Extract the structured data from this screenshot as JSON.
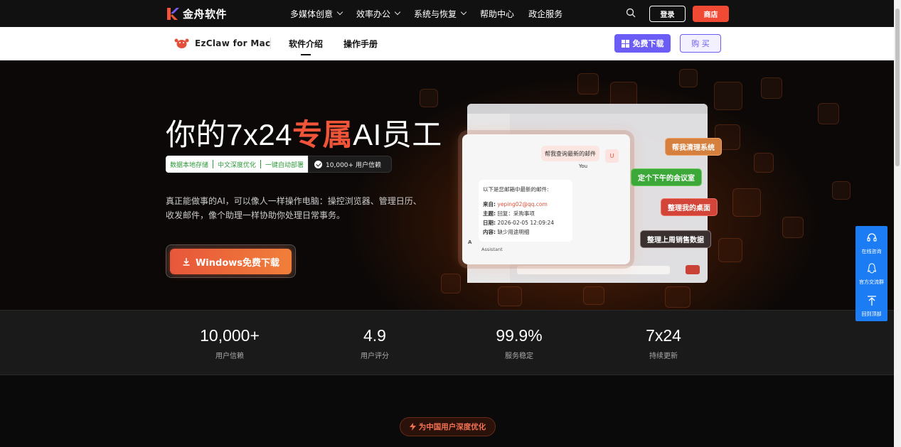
{
  "topnav": {
    "brand": "金舟软件",
    "items": [
      {
        "label": "多媒体创意",
        "dropdown": true
      },
      {
        "label": "效率办公",
        "dropdown": true
      },
      {
        "label": "系统与恢复",
        "dropdown": true
      },
      {
        "label": "帮助中心",
        "dropdown": false
      },
      {
        "label": "政企服务",
        "dropdown": false
      }
    ],
    "login": "登录",
    "shop": "商店"
  },
  "subnav": {
    "product": "EzClaw for Mac",
    "tabs": [
      "软件介绍",
      "操作手册"
    ],
    "download": "免费下载",
    "buy": "购 买"
  },
  "hero": {
    "title_pre": "你的7x24",
    "title_hl": "专属",
    "title_post": "AI员工",
    "tags": [
      "数据本地存储",
      "中文深度优化",
      "一键自动部署"
    ],
    "users": "10,000+ 用户信赖",
    "desc": "真正能做事的AI，可以像人一样操作电脑：操控浏览器、管理日历、收发邮件，像个助理一样协助你处理日常事务。",
    "win_button": "Windows免费下载"
  },
  "chat": {
    "user_msg": "帮我查询最新的邮件",
    "user_avatar": "U",
    "you_label": "You",
    "bot_intro": "以下是您邮箱中最新的邮件:",
    "from_label": "来自:",
    "from_value": "yeping02@qq.com",
    "subject_label": "主题:",
    "subject_value": "回复：采购事项",
    "date_label": "日期:",
    "date_value": "2026-02-05 12:09:24",
    "content_label": "内容:",
    "content_value": "缺少用途明细",
    "bot_avatar": "A",
    "assistant_label": "Assistant"
  },
  "pills": [
    "帮我清理系统",
    "定个下午的会议室",
    "整理我的桌面",
    "整理上周销售数据"
  ],
  "stats": [
    {
      "value": "10,000+",
      "label": "用户信赖"
    },
    {
      "value": "4.9",
      "label": "用户评分"
    },
    {
      "value": "99.9%",
      "label": "服务稳定"
    },
    {
      "value": "7x24",
      "label": "持续更新"
    }
  ],
  "badge": "为中国用户深度优化",
  "float": [
    {
      "label": "在线咨询",
      "icon": "headset-icon"
    },
    {
      "label": "官方交流群",
      "icon": "qq-icon"
    },
    {
      "label": "回到顶部",
      "icon": "arrow-up-icon"
    }
  ],
  "colors": {
    "accent": "#f0553a",
    "purple": "#6a5cf5",
    "float_blue": "#1c7cf4"
  }
}
